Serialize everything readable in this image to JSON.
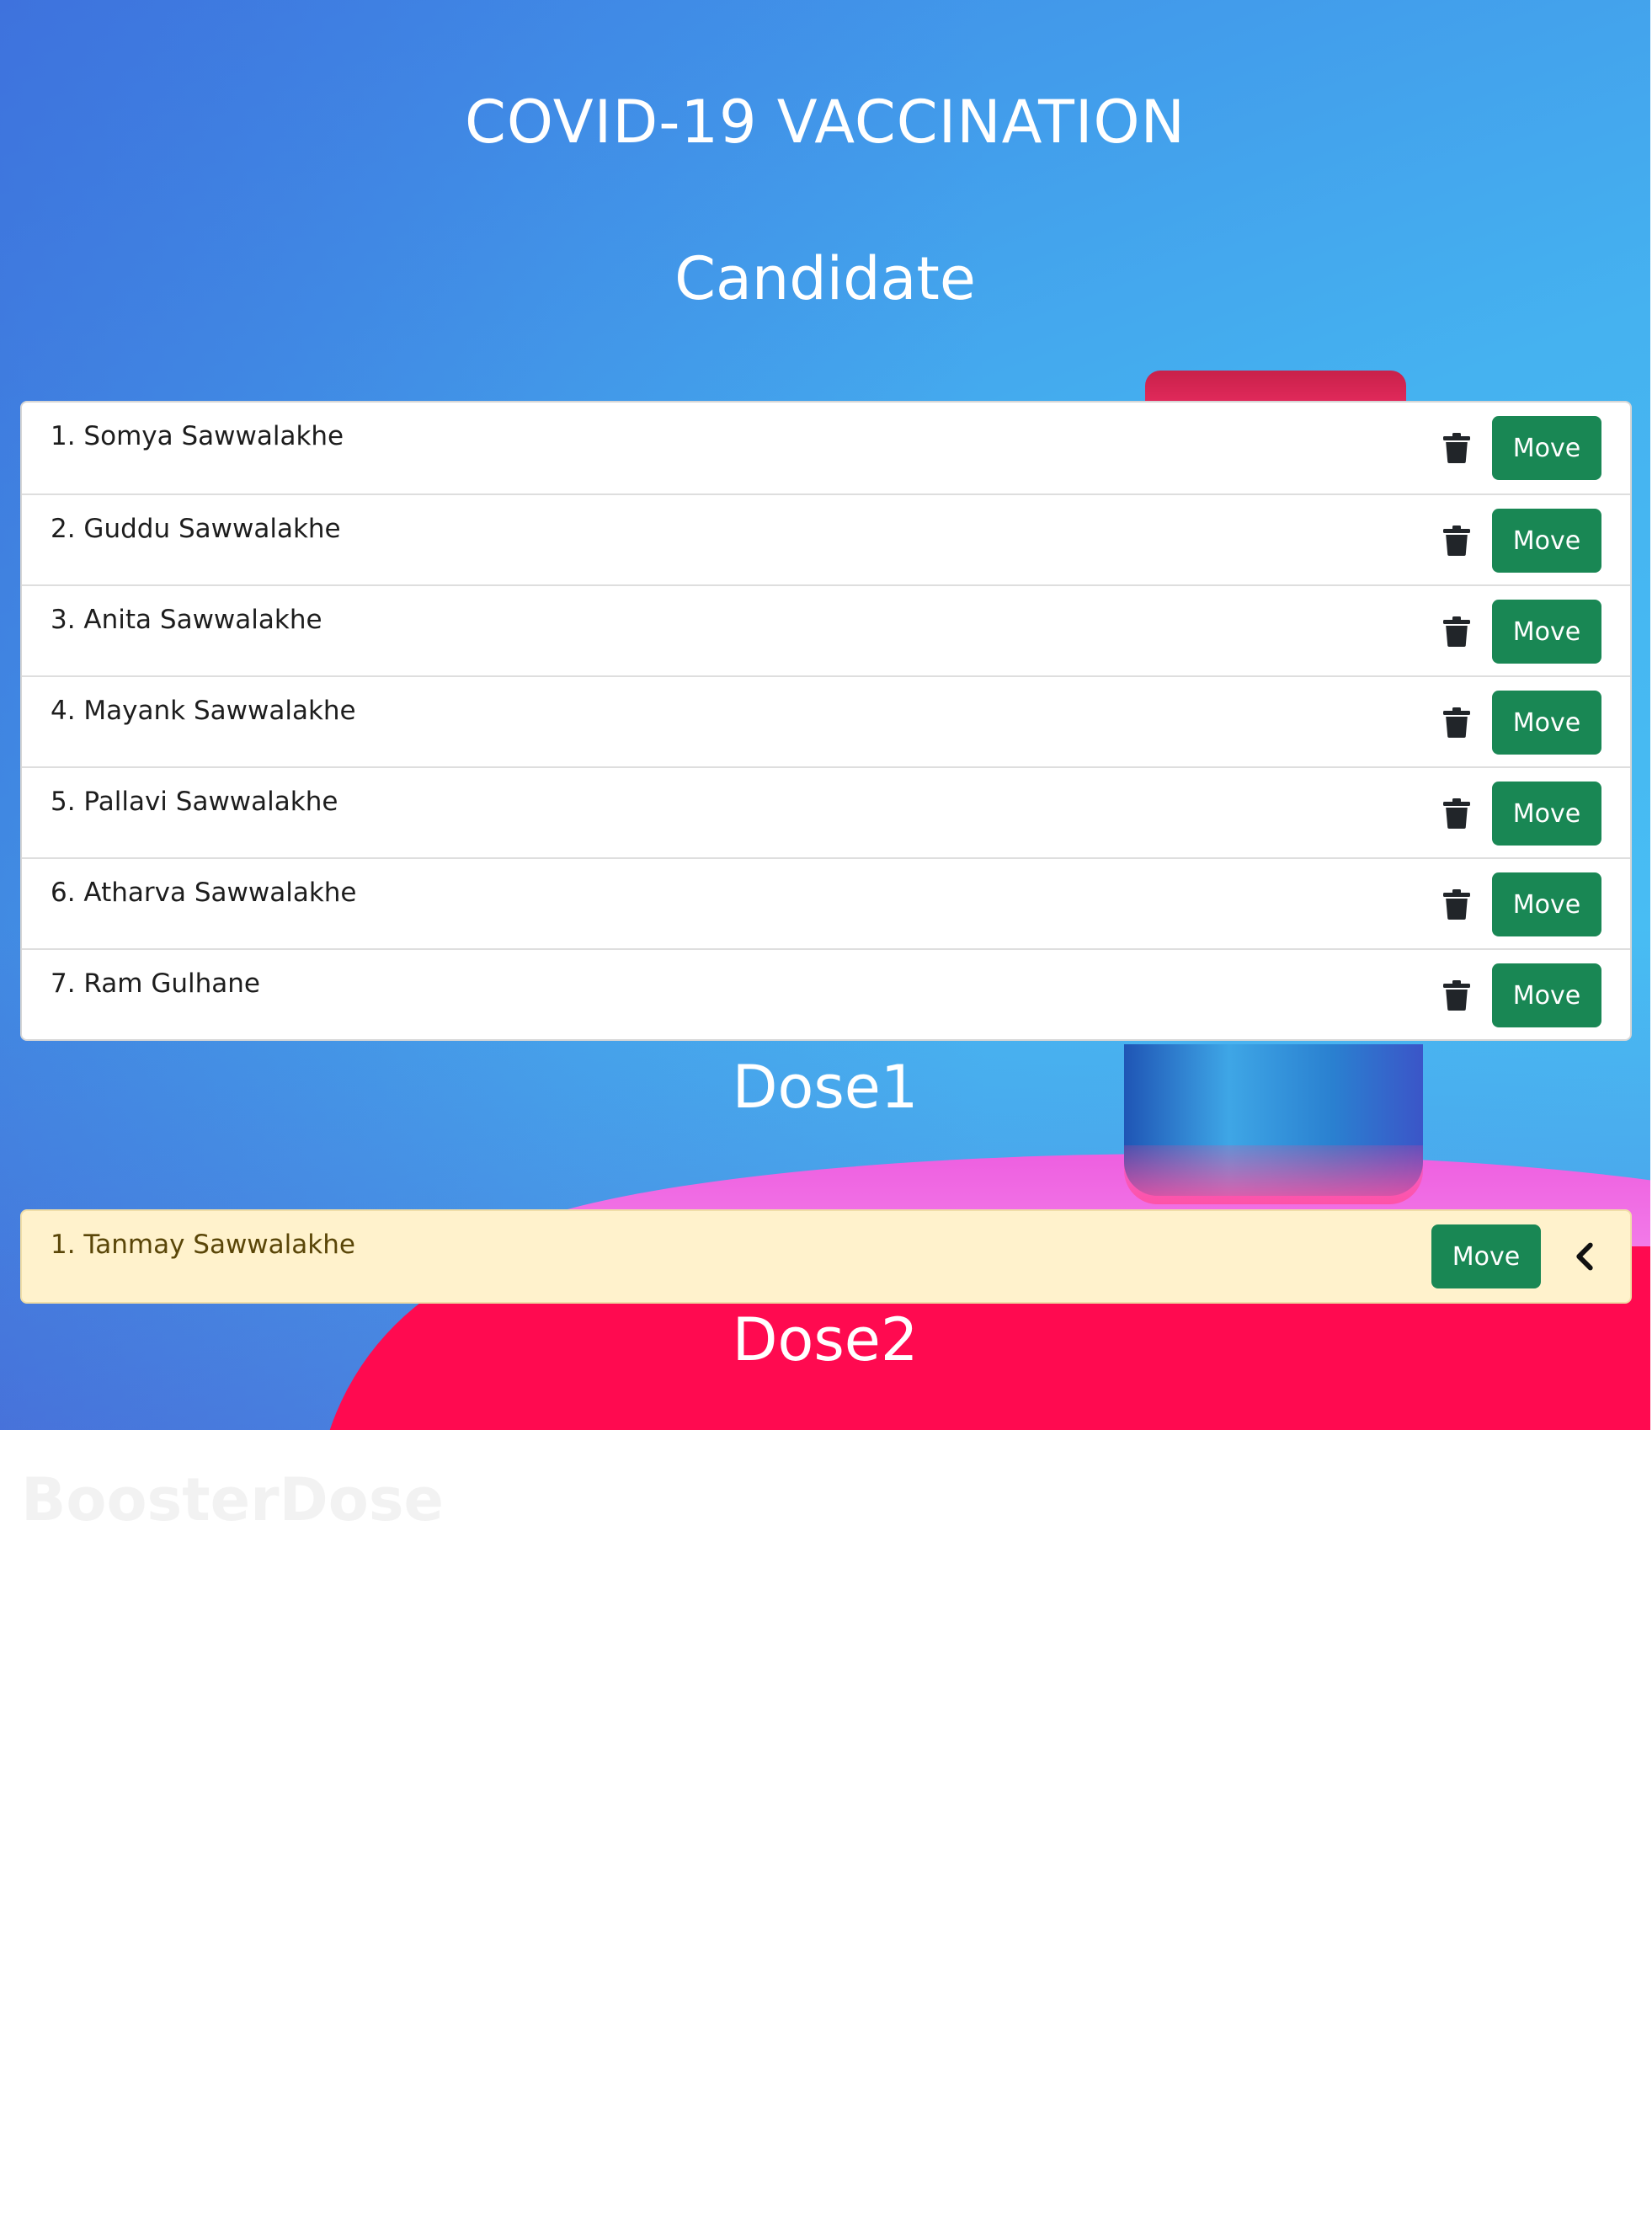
{
  "header": {
    "title": "COVID-19 VACCINATION"
  },
  "candidate": {
    "heading": "Candidate",
    "items": [
      {
        "label": "1. Somya Sawwalakhe",
        "move_label": "Move"
      },
      {
        "label": "2. Guddu Sawwalakhe",
        "move_label": "Move"
      },
      {
        "label": "3. Anita Sawwalakhe",
        "move_label": "Move"
      },
      {
        "label": "4. Mayank Sawwalakhe",
        "move_label": "Move"
      },
      {
        "label": "5. Pallavi Sawwalakhe",
        "move_label": "Move"
      },
      {
        "label": "6. Atharva Sawwalakhe",
        "move_label": "Move"
      },
      {
        "label": "7. Ram Gulhane",
        "move_label": "Move"
      }
    ]
  },
  "dose1": {
    "heading": "Dose1",
    "items": [
      {
        "label": "1. Tanmay Sawwalakhe",
        "move_label": "Move"
      }
    ]
  },
  "dose2": {
    "heading": "Dose2"
  },
  "booster": {
    "heading": "BoosterDose"
  },
  "icons": {
    "delete": "trash-icon",
    "back": "chevron-left-icon"
  },
  "colors": {
    "move_button": "#198754",
    "dose1_row": "#fff2cc",
    "heading_text": "#ffffff"
  }
}
